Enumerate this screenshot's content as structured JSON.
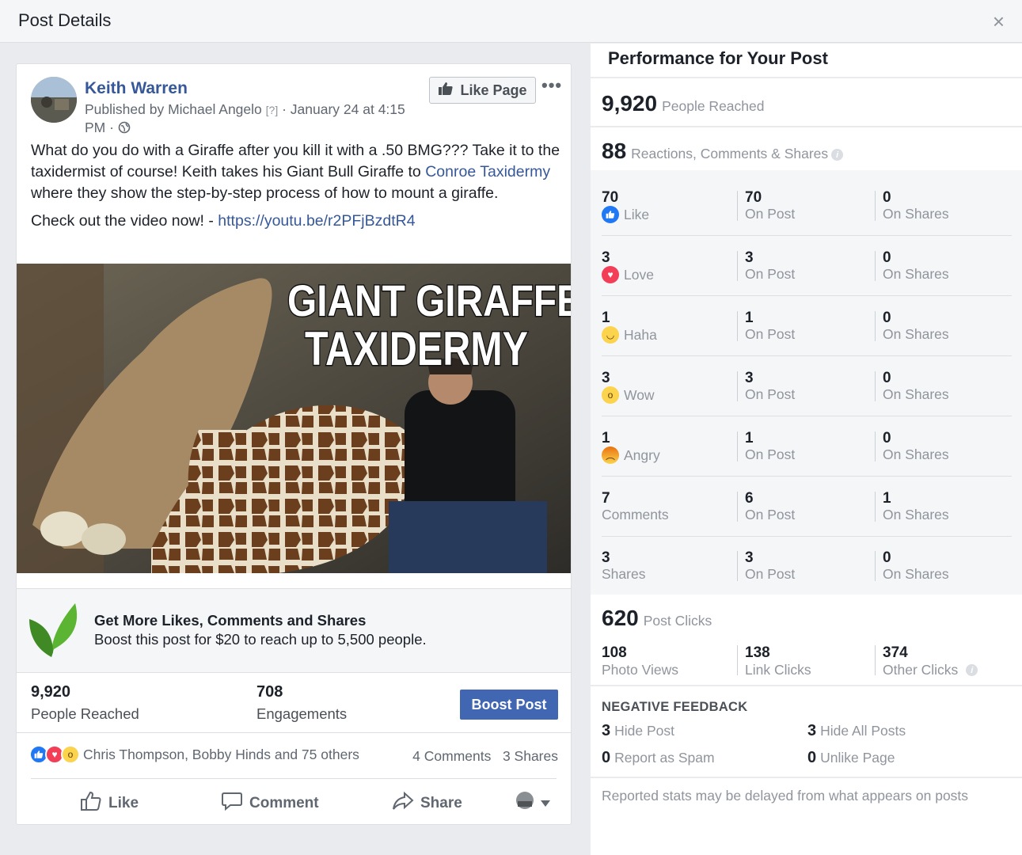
{
  "modal": {
    "title": "Post Details",
    "close": "×"
  },
  "post": {
    "author": "Keith Warren",
    "published_by": "Published by Michael Angelo",
    "help_marker": "[?]",
    "date": "· January 24 at 4:15 PM ·",
    "like_page": "Like Page",
    "more": "•••",
    "text_p1_a": "What do you do with a Giraffe after you kill it with a .50 BMG??? Take it to the taxidermist of course! Keith takes his Giant Bull Giraffe to ",
    "text_p1_link": "Conroe Taxidermy",
    "text_p1_b": " where they show the step-by-step process of how to mount a giraffe.",
    "text_p2_a": "Check out the video now! - ",
    "text_p2_link": "https://youtu.be/r2PFjBzdtR4",
    "image_title_1": "GIANT GIRAFFE",
    "image_title_2": "TAXIDERMY"
  },
  "boost": {
    "title": "Get More Likes, Comments and Shares",
    "subtitle": "Boost this post for $20 to reach up to 5,500 people.",
    "reached_num": "9,920",
    "reached_lbl": "People Reached",
    "eng_num": "708",
    "eng_lbl": "Engagements",
    "button": "Boost Post"
  },
  "social": {
    "reactors": "Chris Thompson, Bobby Hinds and 75 others",
    "comments": "4 Comments",
    "shares": "3 Shares",
    "like": "Like",
    "comment": "Comment",
    "share": "Share"
  },
  "perf": {
    "title": "Performance for Your Post",
    "reached_num": "9,920",
    "reached_lbl": "People Reached",
    "rcs_num": "88",
    "rcs_lbl": "Reactions, Comments & Shares",
    "rows": [
      {
        "n": "70",
        "label": "Like",
        "post": "70",
        "shares": "0"
      },
      {
        "n": "3",
        "label": "Love",
        "post": "3",
        "shares": "0"
      },
      {
        "n": "1",
        "label": "Haha",
        "post": "1",
        "shares": "0"
      },
      {
        "n": "3",
        "label": "Wow",
        "post": "3",
        "shares": "0"
      },
      {
        "n": "1",
        "label": "Angry",
        "post": "1",
        "shares": "0"
      },
      {
        "n": "7",
        "label": "Comments",
        "post": "6",
        "shares": "1"
      },
      {
        "n": "3",
        "label": "Shares",
        "post": "3",
        "shares": "0"
      }
    ],
    "on_post": "On Post",
    "on_shares": "On Shares",
    "clicks_num": "620",
    "clicks_lbl": "Post Clicks",
    "photo_views_num": "108",
    "photo_views_lbl": "Photo Views",
    "link_clicks_num": "138",
    "link_clicks_lbl": "Link Clicks",
    "other_clicks_num": "374",
    "other_clicks_lbl": "Other Clicks",
    "neg_title": "NEGATIVE FEEDBACK",
    "hide_post_num": "3",
    "hide_post_lbl": "Hide Post",
    "hide_all_num": "3",
    "hide_all_lbl": "Hide All Posts",
    "spam_num": "0",
    "spam_lbl": "Report as Spam",
    "unlike_num": "0",
    "unlike_lbl": "Unlike Page",
    "footer": "Reported stats may be delayed from what appears on posts"
  },
  "colors": {
    "link": "#365899",
    "boost_button": "#4267b2"
  }
}
